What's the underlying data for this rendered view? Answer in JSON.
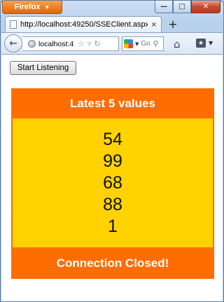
{
  "browser": {
    "menu_button": "Firefox",
    "window_controls": {
      "minimize": "—",
      "maximize": "□",
      "close": "✕"
    },
    "tab": {
      "title": "http://localhost:49250/SSEClient.aspx",
      "close": "×"
    },
    "new_tab": "+",
    "url": "localhost:4",
    "search_placeholder": "Go",
    "icons": [
      "back-icon",
      "globe-icon",
      "star-icon",
      "reload-icon",
      "google-icon",
      "search-icon",
      "home-icon",
      "bookmarks-icon"
    ]
  },
  "page": {
    "start_button": "Start Listening",
    "panel_title": "Latest 5 values",
    "values": [
      "54",
      "99",
      "68",
      "88",
      "1"
    ],
    "status": "Connection Closed!"
  },
  "colors": {
    "panel_orange": "#ff6d00",
    "values_yellow": "#ffd200",
    "firefox_orange": "#e0650e"
  }
}
